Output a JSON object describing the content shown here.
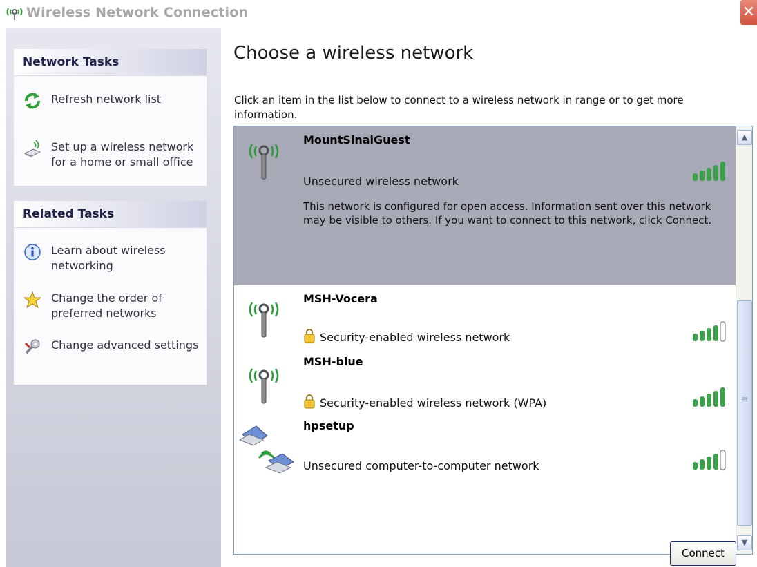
{
  "window": {
    "title": "Wireless Network Connection"
  },
  "network_tasks": {
    "header": "Network Tasks",
    "items": [
      {
        "icon": "refresh-icon",
        "label": "Refresh network list"
      },
      {
        "icon": "wireless-setup-icon",
        "label": "Set up a wireless network for a home or small office"
      }
    ]
  },
  "related_tasks": {
    "header": "Related Tasks",
    "items": [
      {
        "icon": "info-icon",
        "label": "Learn about wireless networking"
      },
      {
        "icon": "star-icon",
        "label": "Change the order of preferred networks"
      },
      {
        "icon": "settings-icon",
        "label": "Change advanced settings"
      }
    ]
  },
  "main": {
    "heading": "Choose a wireless network",
    "instruction": "Click an item in the list below to connect to a wireless network in range or to get more information.",
    "networks": [
      {
        "name": "MountSinaiGuest",
        "status": "Unsecured wireless network",
        "description": "This network is configured for open access. Information sent over this network may be visible to others. If you want to connect to this network, click Connect.",
        "signal_bars": 5,
        "secured": false,
        "selected": true,
        "icon": "antenna-icon"
      },
      {
        "name": "MSH-Vocera",
        "status": "Security-enabled wireless network",
        "signal_bars": 4,
        "secured": true,
        "icon": "antenna-icon"
      },
      {
        "name": "MSH-blue",
        "status": "Security-enabled wireless network (WPA)",
        "signal_bars": 5,
        "secured": true,
        "icon": "antenna-icon"
      },
      {
        "name": "hpsetup",
        "status": "Unsecured computer-to-computer network",
        "signal_bars": 4,
        "secured": false,
        "icon": "computer-to-computer-icon"
      }
    ],
    "connect_label": "Connect"
  },
  "colors": {
    "selected_row": "#a7a9b6",
    "signal_green": "#3ca04a",
    "panel_header_text": "#20234b"
  }
}
